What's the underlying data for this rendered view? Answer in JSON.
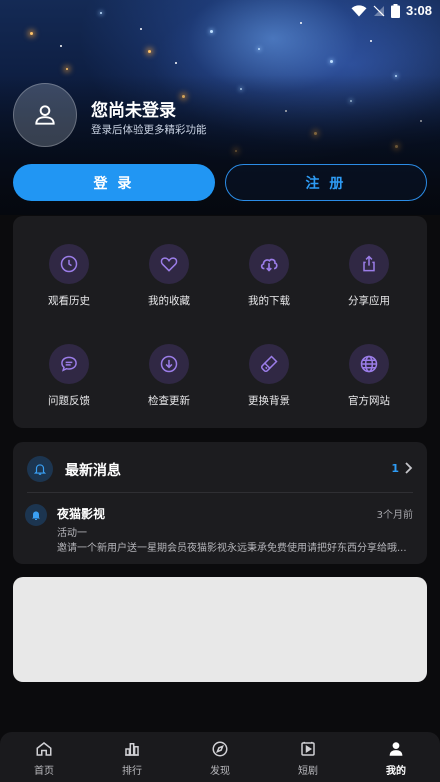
{
  "status_bar": {
    "time": "3:08"
  },
  "profile": {
    "title": "您尚未登录",
    "subtitle": "登录后体验更多精彩功能",
    "login_label": "登 录",
    "register_label": "注 册"
  },
  "features": [
    {
      "label": "观看历史",
      "icon": "clock-icon"
    },
    {
      "label": "我的收藏",
      "icon": "heart-icon"
    },
    {
      "label": "我的下载",
      "icon": "cloud-download-icon"
    },
    {
      "label": "分享应用",
      "icon": "share-icon"
    },
    {
      "label": "问题反馈",
      "icon": "chat-icon"
    },
    {
      "label": "检查更新",
      "icon": "download-circle-icon"
    },
    {
      "label": "更换背景",
      "icon": "brush-icon"
    },
    {
      "label": "官方网站",
      "icon": "globe-icon"
    }
  ],
  "notices": {
    "title": "最新消息",
    "count": "1",
    "items": [
      {
        "title": "夜猫影视",
        "time": "3个月前",
        "subtitle": "活动一",
        "body": "邀请一个新用户送一星期会员夜猫影视永远秉承免费使用请把好东西分享给哦..."
      }
    ]
  },
  "bottom_nav": [
    {
      "label": "首页",
      "icon": "home-icon",
      "active": false
    },
    {
      "label": "排行",
      "icon": "ranking-icon",
      "active": false
    },
    {
      "label": "发现",
      "icon": "compass-icon",
      "active": false
    },
    {
      "label": "短剧",
      "icon": "play-square-icon",
      "active": false
    },
    {
      "label": "我的",
      "icon": "user-icon",
      "active": true
    }
  ],
  "colors": {
    "accent": "#2196f3",
    "card_bg": "#1c1c1f",
    "icon_bg": "#302844",
    "icon_fg": "#9b7de8",
    "page_bg": "#0b0b0d"
  }
}
